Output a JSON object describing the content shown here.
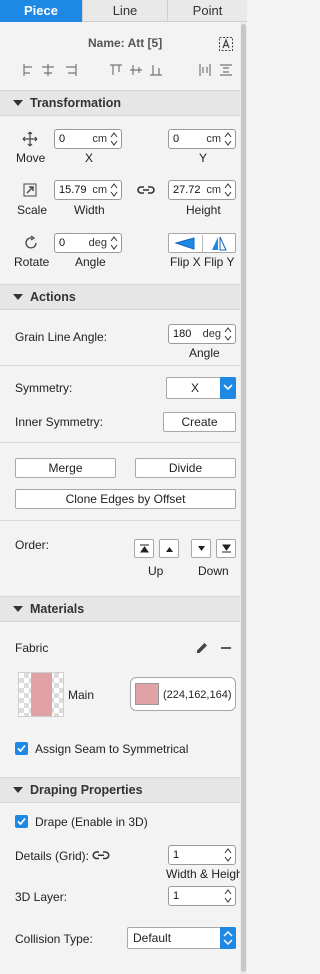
{
  "tabs": [
    "Piece",
    "Line",
    "Point"
  ],
  "piece_name": "Name: Att [5]",
  "transformation": {
    "title": "Transformation",
    "move_label": "Move",
    "x_value": "0",
    "x_unit": "cm",
    "x_label": "X",
    "y_value": "0",
    "y_unit": "cm",
    "y_label": "Y",
    "scale_label": "Scale",
    "width_value": "15.79",
    "width_unit": "cm",
    "width_label": "Width",
    "height_value": "27.72",
    "height_unit": "cm",
    "height_label": "Height",
    "rotate_label": "Rotate",
    "angle_value": "0",
    "angle_unit": "deg",
    "angle_label": "Angle",
    "flip_x_label": "Flip X",
    "flip_y_label": "Flip Y"
  },
  "actions": {
    "title": "Actions",
    "grain_label": "Grain Line Angle:",
    "grain_value": "180",
    "grain_unit": "deg",
    "grain_sub": "Angle",
    "symmetry_label": "Symmetry:",
    "symmetry_value": "X",
    "inner_symmetry_label": "Inner Symmetry:",
    "create_label": "Create",
    "merge_label": "Merge",
    "divide_label": "Divide",
    "clone_label": "Clone Edges by Offset",
    "order_label": "Order:",
    "up_label": "Up",
    "down_label": "Down"
  },
  "materials": {
    "title": "Materials",
    "fabric_label": "Fabric",
    "main_label": "Main",
    "color_text": "(224,162,164)",
    "color": "#e0a2a4",
    "assign_label": "Assign Seam to Symmetrical",
    "assign_checked": true
  },
  "draping": {
    "title": "Draping Properties",
    "drape_label": "Drape (Enable in 3D)",
    "drape_checked": true,
    "details_label": "Details (Grid):",
    "details_value": "1",
    "details_sub": "Width & Height",
    "layer_label": "3D Layer:",
    "layer_value": "1",
    "collision_label": "Collision Type:",
    "collision_value": "Default"
  },
  "colors": {
    "accent": "#1e88e5"
  }
}
